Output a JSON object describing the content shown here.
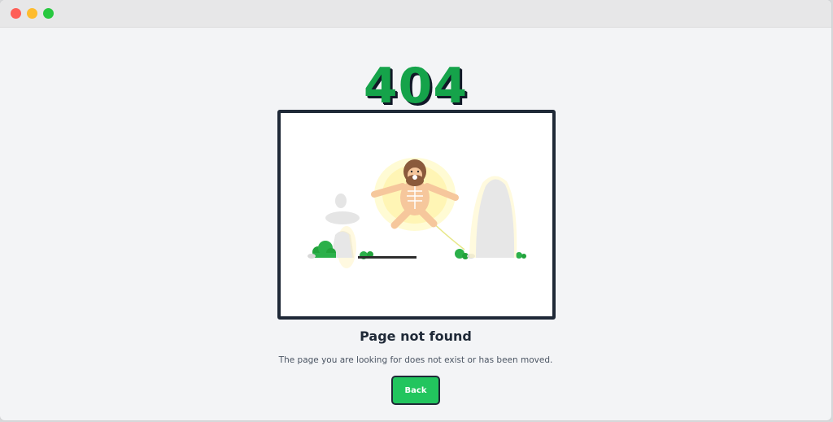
{
  "error_code": "404",
  "title": "Page not found",
  "message": "The page you are looking for does not exist or has been moved.",
  "back_button": "Back",
  "colors": {
    "accent": "#22c55e",
    "code": "#15a34a",
    "dark": "#1f2937",
    "background": "#f3f4f6"
  },
  "illustration": "electrocuted-caveman"
}
